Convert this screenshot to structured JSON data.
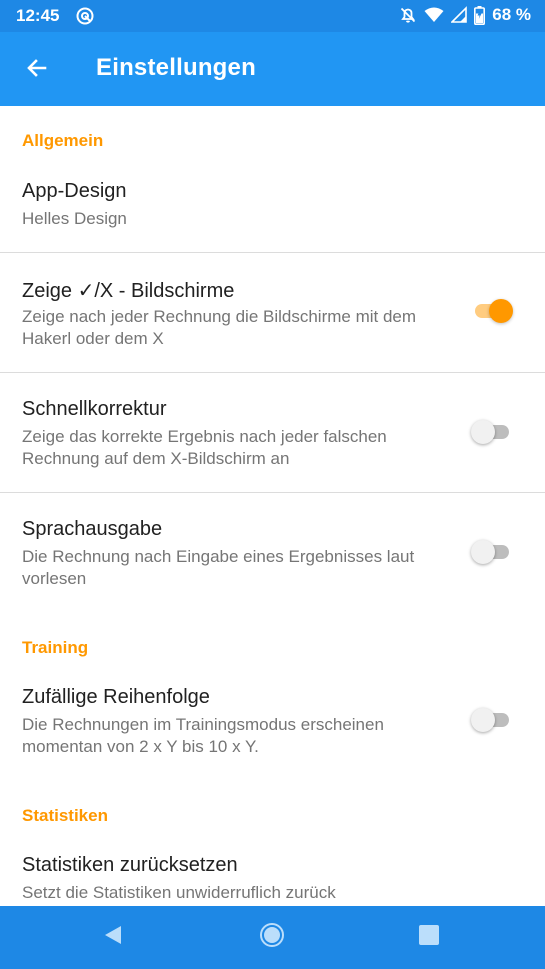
{
  "status_bar": {
    "time": "12:45",
    "battery_text": "68 %"
  },
  "app_bar": {
    "title": "Einstellungen",
    "back_icon": "arrow-back-icon"
  },
  "sections": {
    "general": {
      "header": "Allgemein",
      "app_design": {
        "title": "App-Design",
        "summary": "Helles Design"
      },
      "show_screens": {
        "title": "Zeige ✓/X - Bildschirme",
        "summary": "Zeige nach jeder Rechnung die Bildschirme mit dem Hakerl oder dem X",
        "enabled": true
      },
      "quick_correction": {
        "title": "Schnellkorrektur",
        "summary": "Zeige das korrekte Ergebnis nach jeder falschen Rechnung auf dem X-Bildschirm an",
        "enabled": false
      },
      "speech": {
        "title": "Sprachausgabe",
        "summary": "Die Rechnung nach Eingabe eines Ergebnisses laut vorlesen",
        "enabled": false
      }
    },
    "training": {
      "header": "Training",
      "random_order": {
        "title": "Zufällige Reihenfolge",
        "summary": "Die Rechnungen im Trainingsmodus erscheinen momentan von 2 x Y bis 10 x Y.",
        "enabled": false
      }
    },
    "statistics": {
      "header": "Statistiken",
      "reset": {
        "title": "Statistiken zurücksetzen",
        "summary": "Setzt die Statistiken unwiderruflich zurück"
      }
    }
  },
  "colors": {
    "status_bar": "#1e88e5",
    "app_bar": "#2196f3",
    "accent": "#ff9800",
    "nav_bar": "#1e88e5"
  },
  "nav_bar": {
    "back": "nav-back-icon",
    "home": "nav-home-icon",
    "recents": "nav-recents-icon"
  }
}
